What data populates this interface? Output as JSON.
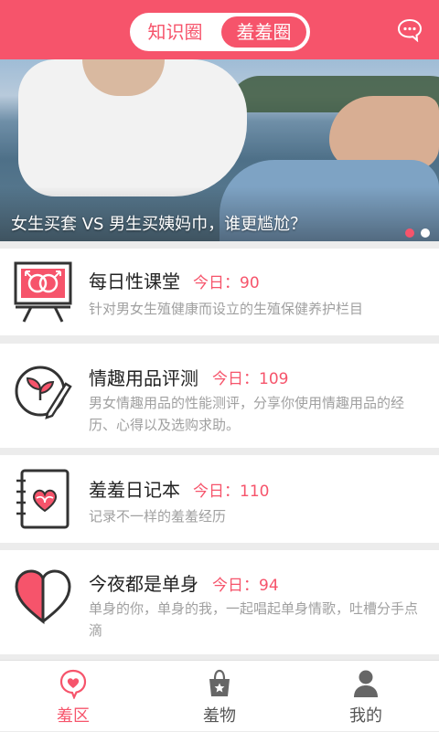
{
  "header": {
    "segment_left": "知识圈",
    "segment_right": "羞羞圈",
    "message_icon": "chat-bubble-icon"
  },
  "banner": {
    "caption": "女生买套 VS 男生买姨妈巾，谁更尴尬？",
    "slide_count": 2,
    "active_slide": 1
  },
  "cards": [
    {
      "title": "每日性课堂",
      "today": "今日：90",
      "desc": "针对男女生殖健康而设立的生殖保健养护栏目",
      "icon": "classroom-board-icon"
    },
    {
      "title": "情趣用品评测",
      "today": "今日：109",
      "desc": "男女情趣用品的性能测评，分享你使用情趣用品的经历、心得以及选购求助。",
      "icon": "leaf-pen-icon"
    },
    {
      "title": "羞羞日记本",
      "today": "今日：110",
      "desc": "记录不一样的羞羞经历",
      "icon": "heart-notebook-icon"
    },
    {
      "title": "今夜都是单身",
      "today": "今日：94",
      "desc": "单身的你，单身的我，一起唱起单身情歌，吐槽分手点滴",
      "icon": "half-heart-icon"
    }
  ],
  "tabs": [
    {
      "label": "羞区",
      "icon": "heart-bubble-icon",
      "active": true
    },
    {
      "label": "羞物",
      "icon": "gift-bag-icon",
      "active": false
    },
    {
      "label": "我的",
      "icon": "user-icon",
      "active": false
    }
  ],
  "colors": {
    "accent": "#f6546b",
    "inactive": "#555555",
    "desc": "#a0a0a0"
  }
}
